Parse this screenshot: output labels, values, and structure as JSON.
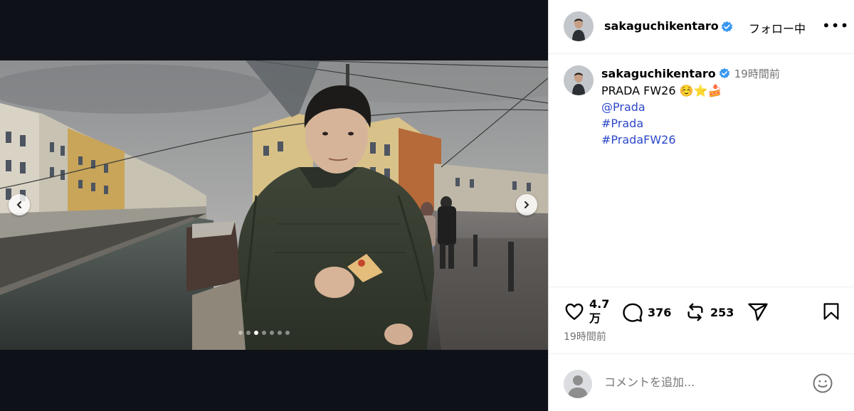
{
  "post": {
    "username": "sakaguchikentaro",
    "follow_status": "フォロー中",
    "more_label": "•••",
    "caption_line1": "PRADA  FW26 ☺️⭐🍰",
    "caption_links": [
      "@Prada",
      "#Prada",
      "#PradaFW26"
    ],
    "caption_time": "19時間前",
    "likes": "4.7\n万",
    "likes_line1": "4.7",
    "likes_line2": "万",
    "comments": "376",
    "reposts": "253",
    "timestamp": "19時間前",
    "comment_placeholder": "コメントを追加...",
    "carousel": {
      "total": 7,
      "active_index": 2
    }
  },
  "icons": {
    "prev": "chevron-left-icon",
    "next": "chevron-right-icon",
    "verified": "verified-badge-icon",
    "like": "heart-icon",
    "comment": "comment-bubble-icon",
    "repost": "repost-icon",
    "share": "send-icon",
    "save": "bookmark-icon",
    "emoji": "emoji-smile-icon"
  },
  "colors": {
    "verified": "#3897f0",
    "link": "#2b47c9",
    "secondary_text": "#737373",
    "media_background": "#0e1117"
  }
}
